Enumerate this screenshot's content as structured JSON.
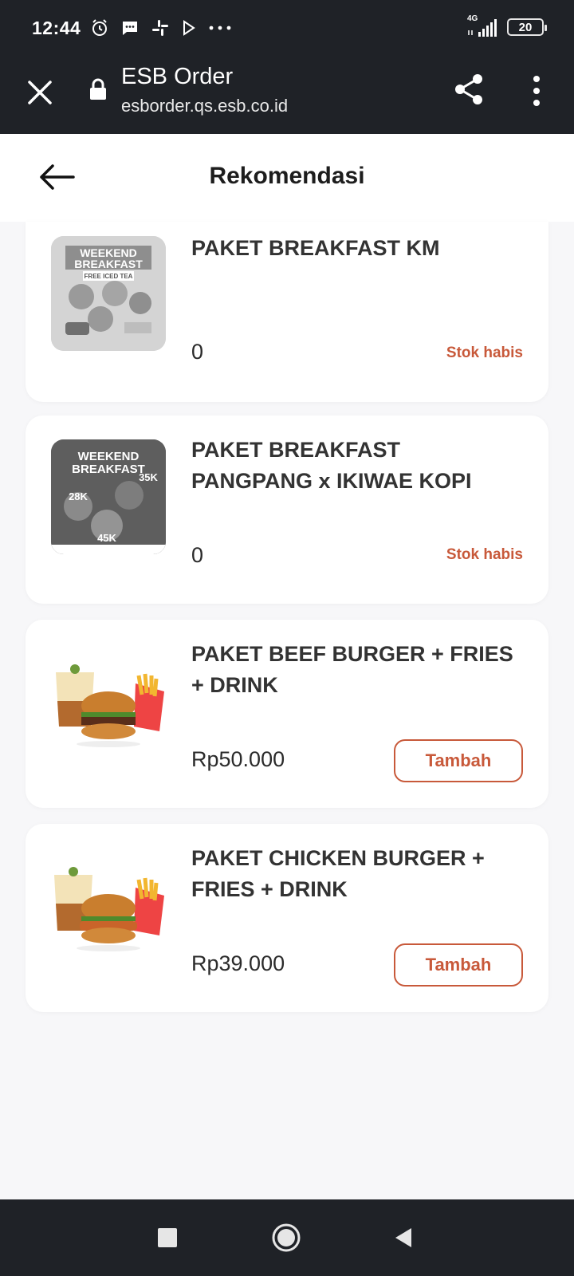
{
  "status_bar": {
    "time": "12:44",
    "network": "4G",
    "battery": "20",
    "icons": [
      "alarm-icon",
      "message-icon",
      "slack-icon",
      "play-store-icon",
      "more-dots-icon",
      "signal-icon",
      "battery-icon"
    ]
  },
  "browser": {
    "title": "ESB Order",
    "url": "esborder.qs.esb.co.id"
  },
  "header": {
    "title": "Rekomendasi"
  },
  "products": [
    {
      "name": "PAKET BREAKFAST KM",
      "price": "0",
      "status": "Stok habis",
      "thumb_text": [
        "WEEKEND",
        "BREAKFAST",
        "FREE ICED TEA"
      ]
    },
    {
      "name": "PAKET BREAKFAST PANGPANG x IKIWAE KOPI",
      "price": "0",
      "status": "Stok habis",
      "thumb_text": [
        "WEEKEND",
        "BREAKFAST",
        "28K",
        "35K",
        "45K"
      ]
    },
    {
      "name": "PAKET BEEF BURGER + FRIES + DRINK",
      "price": "Rp50.000",
      "button": "Tambah"
    },
    {
      "name": "PAKET CHICKEN BURGER + FRIES + DRINK",
      "price": "Rp39.000",
      "button": "Tambah"
    }
  ],
  "colors": {
    "accent": "#c8593a",
    "dark_bar": "#1f2227",
    "background": "#f7f7f9"
  }
}
